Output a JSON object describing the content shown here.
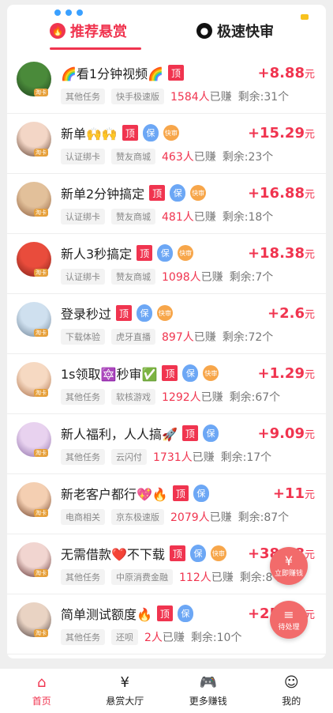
{
  "tabs": [
    {
      "label": "推荐悬赏",
      "active": true,
      "icon": "flame-icon"
    },
    {
      "label": "极速快审",
      "active": false,
      "icon": "user-circle-icon"
    }
  ],
  "tasks": [
    {
      "title": "🌈看1分钟视频🌈",
      "badges": [
        "顶"
      ],
      "amount": "+8.88",
      "unit": "元",
      "tags": [
        "其他任务",
        "快手极速版"
      ],
      "earned_count": "1584人",
      "earned_suffix": "已赚",
      "remaining": "剩余:31个",
      "avatar_colors": [
        "#4a8a3a",
        "#1b3d1a"
      ]
    },
    {
      "title": "新单🙌🙌",
      "badges": [
        "顶",
        "保",
        "快审"
      ],
      "amount": "+15.29",
      "unit": "元",
      "tags": [
        "认证绑卡",
        "赞友商城"
      ],
      "earned_count": "463人",
      "earned_suffix": "已赚",
      "remaining": "剩余:23个",
      "avatar_colors": [
        "#f3d6c6",
        "#5a3a2a"
      ]
    },
    {
      "title": "新单2分钟搞定",
      "badges": [
        "顶",
        "保",
        "快审"
      ],
      "amount": "+16.88",
      "unit": "元",
      "tags": [
        "认证绑卡",
        "赞友商城"
      ],
      "earned_count": "481人",
      "earned_suffix": "已赚",
      "remaining": "剩余:18个",
      "avatar_colors": [
        "#e2c09a",
        "#8a5a3a"
      ]
    },
    {
      "title": "新人3秒搞定",
      "badges": [
        "顶",
        "保",
        "快审"
      ],
      "amount": "+18.38",
      "unit": "元",
      "tags": [
        "认证绑卡",
        "赞友商城"
      ],
      "earned_count": "1098人",
      "earned_suffix": "已赚",
      "remaining": "剩余:7个",
      "avatar_colors": [
        "#e94c3c",
        "#7a1f17"
      ]
    },
    {
      "title": "登录秒过",
      "badges": [
        "顶",
        "保",
        "快审"
      ],
      "amount": "+2.6",
      "unit": "元",
      "tags": [
        "下载体验",
        "虎牙直播"
      ],
      "earned_count": "897人",
      "earned_suffix": "已赚",
      "remaining": "剩余:72个",
      "avatar_colors": [
        "#cfe0ef",
        "#6a7f93"
      ]
    },
    {
      "title": "1s领取🔯秒审✅",
      "badges": [
        "顶",
        "保",
        "快审"
      ],
      "amount": "+1.29",
      "unit": "元",
      "tags": [
        "其他任务",
        "软核游戏"
      ],
      "earned_count": "1292人",
      "earned_suffix": "已赚",
      "remaining": "剩余:67个",
      "avatar_colors": [
        "#f6d9c2",
        "#a86a42"
      ]
    },
    {
      "title": "新人福利，人人搞🚀",
      "badges": [
        "顶",
        "保"
      ],
      "amount": "+9.09",
      "unit": "元",
      "tags": [
        "其他任务",
        "云闪付"
      ],
      "earned_count": "1731人",
      "earned_suffix": "已赚",
      "remaining": "剩余:17个",
      "avatar_colors": [
        "#e8d2ef",
        "#8a6aa6"
      ]
    },
    {
      "title": "新老客户都行💖🔥",
      "badges": [
        "顶",
        "保"
      ],
      "amount": "+11",
      "unit": "元",
      "tags": [
        "电商相关",
        "京东极速版"
      ],
      "earned_count": "2079人",
      "earned_suffix": "已赚",
      "remaining": "剩余:87个",
      "avatar_colors": [
        "#f4cfb2",
        "#6a3a22"
      ]
    },
    {
      "title": "无需借款❤️不下载",
      "badges": [
        "顶",
        "保",
        "快审"
      ],
      "amount": "+38.88",
      "unit": "元",
      "tags": [
        "其他任务",
        "中原消费金融"
      ],
      "earned_count": "112人",
      "earned_suffix": "已赚",
      "remaining": "剩余:8个",
      "avatar_colors": [
        "#f1d5d0",
        "#5a2a2a"
      ]
    },
    {
      "title": "简单测试额度🔥",
      "badges": [
        "顶",
        "保"
      ],
      "amount": "+25.88",
      "unit": "元",
      "tags": [
        "其他任务",
        "还呗"
      ],
      "earned_count": "2人",
      "earned_suffix": "已赚",
      "remaining": "剩余:10个",
      "avatar_colors": [
        "#e9d3c3",
        "#4a3b3b"
      ]
    }
  ],
  "float_buttons": [
    {
      "label": "立即赚钱",
      "icon": "yen-icon"
    },
    {
      "label": "待处理",
      "icon": "list-icon"
    }
  ],
  "avatar_tag": "淘卡",
  "bottom_nav": [
    {
      "label": "首页",
      "icon": "home-icon",
      "active": true
    },
    {
      "label": "悬赏大厅",
      "icon": "yen-icon",
      "active": false
    },
    {
      "label": "更多赚钱",
      "icon": "gamepad-icon",
      "active": false
    },
    {
      "label": "我的",
      "icon": "user-icon",
      "active": false
    }
  ],
  "colors": {
    "accent": "#f0344f",
    "bao": "#6ca7f5",
    "kuai": "#f7a64a",
    "float": "#f26b6b"
  }
}
